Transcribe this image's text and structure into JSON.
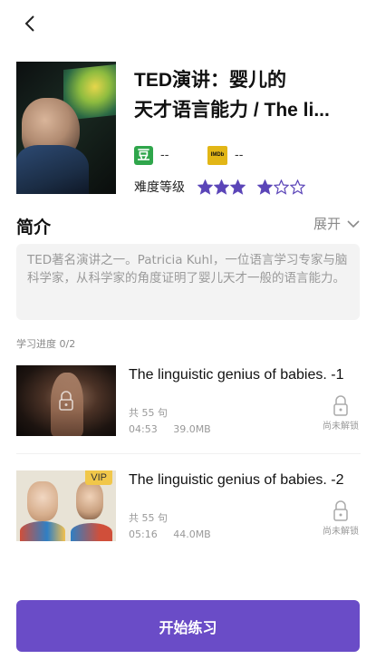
{
  "header": {
    "back_icon": "chevron-left-icon"
  },
  "course": {
    "title_line1": "TED演讲：婴儿的",
    "title_line2": "天才语言能力 / The li...",
    "douban_label": "豆",
    "douban_rating": "--",
    "imdb_label": "IMDb",
    "imdb_rating": "--",
    "difficulty_label": "难度等级",
    "difficulty_level": 4,
    "difficulty_max": 6
  },
  "intro": {
    "title": "简介",
    "expand_label": "展开",
    "text": "TED著名演讲之一。Patricia Kuhl，一位语言学习专家与脑科学家，从科学家的角度证明了婴儿天才一般的语言能力。"
  },
  "progress_label": "学习进度 0/2",
  "lessons": [
    {
      "title": "The linguistic genius of babies. -1",
      "count": "共 55 句",
      "duration": "04:53",
      "size": "39.0MB",
      "lock_label": "尚未解锁",
      "vip": null
    },
    {
      "title": "The linguistic genius of babies. -2",
      "count": "共 55 句",
      "duration": "05:16",
      "size": "44.0MB",
      "lock_label": "尚未解锁",
      "vip": "VIP"
    }
  ],
  "start_button": "开始练习",
  "colors": {
    "accent": "#6a4cc7",
    "star": "#5b45b8",
    "douban": "#2fa64b",
    "imdb": "#e2b616",
    "vip": "#f1c74a"
  }
}
